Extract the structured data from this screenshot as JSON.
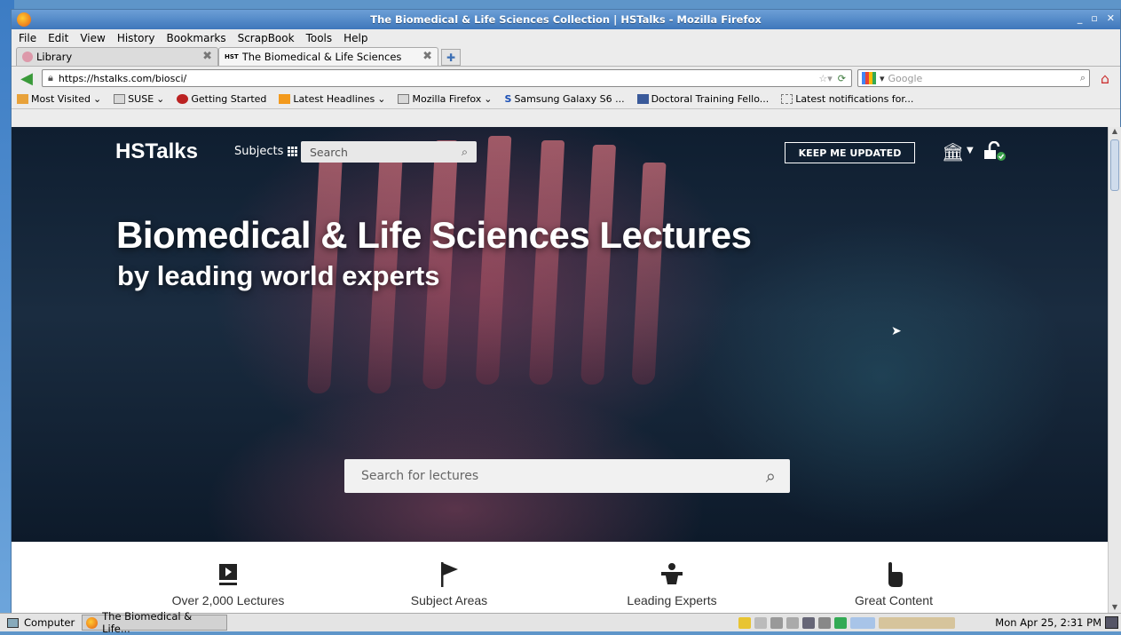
{
  "window": {
    "title": "The Biomedical & Life Sciences Collection | HSTalks - Mozilla Firefox",
    "controls": [
      "_",
      "▫",
      "✕"
    ]
  },
  "menu": {
    "items": [
      "File",
      "Edit",
      "View",
      "History",
      "Bookmarks",
      "ScrapBook",
      "Tools",
      "Help"
    ]
  },
  "tabs": [
    {
      "label": "Library",
      "favicon": "library-icon"
    },
    {
      "label": "The Biomedical & Life Sciences ...",
      "favicon_text": "HST"
    }
  ],
  "navbar": {
    "url": "https://hstalks.com/biosci/",
    "search_placeholder": "Google"
  },
  "bookmarks": [
    {
      "label": "Most Visited",
      "dropdown": true
    },
    {
      "label": "SUSE",
      "dropdown": true
    },
    {
      "label": "Getting Started"
    },
    {
      "label": "Latest Headlines",
      "dropdown": true
    },
    {
      "label": "Mozilla Firefox",
      "dropdown": true
    },
    {
      "label": "Samsung Galaxy S6 ..."
    },
    {
      "label": "Doctoral Training Fello..."
    },
    {
      "label": "Latest notifications for..."
    }
  ],
  "site": {
    "logo": "HSTalks",
    "subjects_label": "Subjects",
    "search_placeholder": "Search",
    "keep_updated": "KEEP ME UPDATED",
    "hero_title": "Biomedical & Life Sciences Lectures",
    "hero_subtitle": "by leading world experts",
    "lecture_search_placeholder": "Search for lectures",
    "features": [
      {
        "label": "Over 2,000 Lectures",
        "icon": "video-icon"
      },
      {
        "label": "Subject Areas",
        "icon": "flag-icon"
      },
      {
        "label": "Leading Experts",
        "icon": "lecturer-icon"
      },
      {
        "label": "Great Content",
        "icon": "pointer-hand-icon"
      }
    ]
  },
  "taskbar": {
    "computer_label": "Computer",
    "task_label": "The Biomedical & Life...",
    "clock": "Mon Apr 25,  2:31 PM"
  },
  "colors": {
    "titlebar": "#4a82c4",
    "hero_bg": "#142638",
    "accent_green": "#3a9a3a"
  }
}
